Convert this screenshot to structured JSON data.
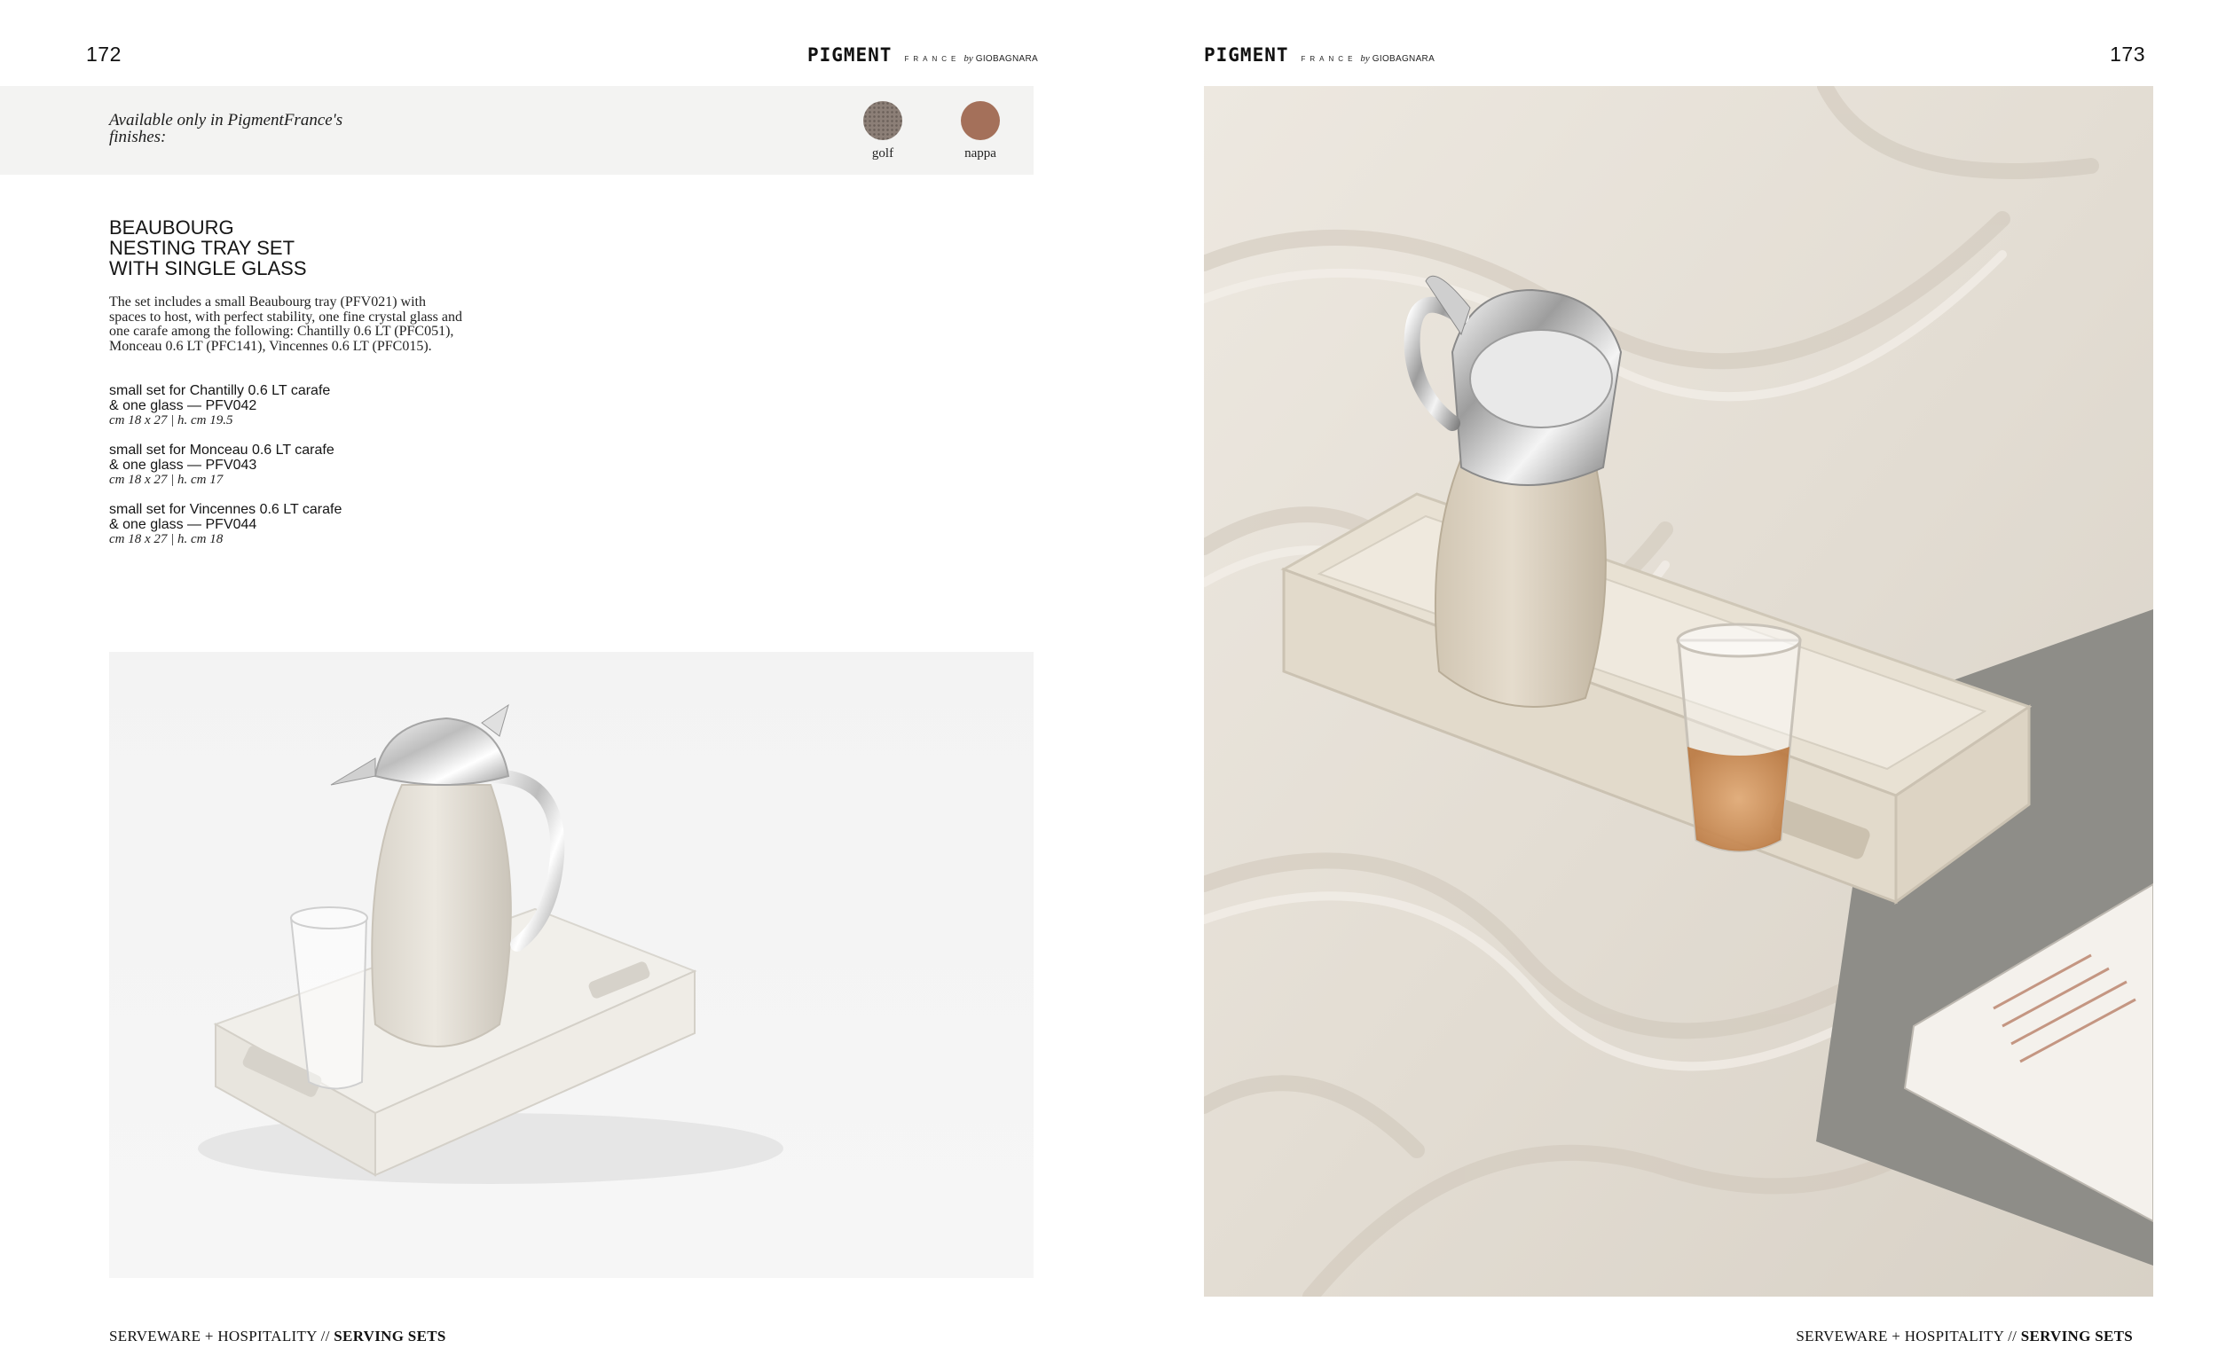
{
  "header": {
    "left_page_number": "172",
    "right_page_number": "173",
    "brand": {
      "main": "PIGMENT",
      "sub": "FRANCE",
      "by": "by",
      "maker": "GIOBAGNARA"
    }
  },
  "finishes": {
    "label": "Available only in PigmentFrance's finishes:",
    "items": [
      {
        "name": "golf",
        "color": "#8c7f77"
      },
      {
        "name": "nappa",
        "color": "#a4705a"
      }
    ]
  },
  "product": {
    "title_lines": [
      "BEAUBOURG",
      "NESTING TRAY SET",
      "WITH SINGLE GLASS"
    ],
    "description": "The set includes a small Beaubourg tray (PFV021) with spaces to host, with perfect stability, one fine crystal glass and one carafe among the following: Chantilly 0.6 LT (PFC051), Monceau 0.6 LT (PFC141), Vincennes 0.6 LT (PFC015).",
    "variants": [
      {
        "line1": "small set for Chantilly 0.6 LT carafe",
        "line2": "& one glass — PFV042",
        "dims": "cm 18 x 27 | h. cm 19.5"
      },
      {
        "line1": "small set for Monceau 0.6 LT carafe",
        "line2": "& one glass — PFV043",
        "dims": "cm 18 x 27 | h. cm 17"
      },
      {
        "line1": "small set for Vincennes 0.6 LT carafe",
        "line2": "& one glass — PFV044",
        "dims": "cm 18 x 27 | h. cm 18"
      }
    ]
  },
  "footer": {
    "section": "SERVEWARE + HOSPITALITY //",
    "subsection": "SERVING SETS"
  }
}
